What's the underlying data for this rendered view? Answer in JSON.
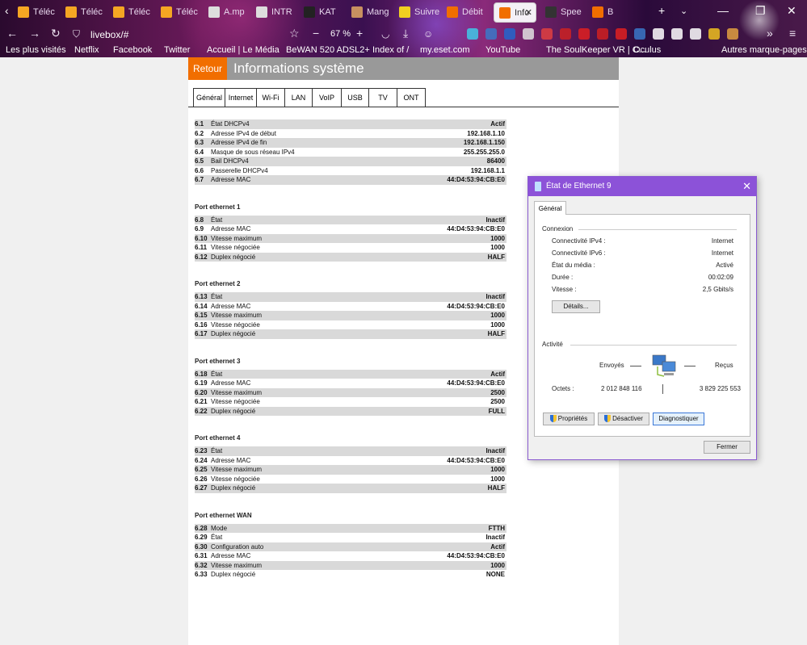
{
  "browser": {
    "tabs": [
      {
        "label": "Téléc",
        "color": "#f5a623"
      },
      {
        "label": "Téléc",
        "color": "#f5a623"
      },
      {
        "label": "Téléc",
        "color": "#f5a623"
      },
      {
        "label": "Téléc",
        "color": "#f5a623"
      },
      {
        "label": "A.mp",
        "color": "#dddddd"
      },
      {
        "label": "INTR",
        "color": "#dddddd"
      },
      {
        "label": "KAT",
        "color": "#222222"
      },
      {
        "label": "Mang",
        "color": "#c89060"
      },
      {
        "label": "Suivre",
        "color": "#f0d020"
      },
      {
        "label": "Débit",
        "color": "#f16e00"
      },
      {
        "label": "Info",
        "color": "#f16e00"
      },
      {
        "label": "Spee",
        "color": "#333333"
      },
      {
        "label": "B",
        "color": "#f16e00"
      }
    ],
    "url": "livebox/#",
    "zoom": "67 %",
    "bookmarks": [
      "Les plus visités",
      "Netflix",
      "Facebook",
      "Twitter",
      "Accueil | Le Média",
      "BeWAN 520 ADSL2+",
      "Index of /",
      "my.eset.com",
      "YouTube",
      "The SoulKeeper VR | C...",
      "Oculus",
      "Autres marque-pages"
    ]
  },
  "page": {
    "retour": "Retour",
    "title": "Informations système",
    "tabs": [
      "Général",
      "Internet",
      "Wi-Fi",
      "LAN",
      "VoIP",
      "USB",
      "TV",
      "ONT"
    ],
    "sections": [
      {
        "title": "",
        "rows": [
          [
            "6.1",
            "État DHCPv4",
            "Actif"
          ],
          [
            "6.2",
            "Adresse IPv4 de début",
            "192.168.1.10"
          ],
          [
            "6.3",
            "Adresse IPv4 de fin",
            "192.168.1.150"
          ],
          [
            "6.4",
            "Masque de sous réseau IPv4",
            "255.255.255.0"
          ],
          [
            "6.5",
            "Bail DHCPv4",
            "86400"
          ],
          [
            "6.6",
            "Passerelle DHCPv4",
            "192.168.1.1"
          ],
          [
            "6.7",
            "Adresse MAC",
            "44:D4:53:94:CB:E0"
          ]
        ]
      },
      {
        "title": "Port ethernet 1",
        "rows": [
          [
            "6.8",
            "État",
            "Inactif"
          ],
          [
            "6.9",
            "Adresse MAC",
            "44:D4:53:94:CB:E0"
          ],
          [
            "6.10",
            "Vitesse maximum",
            "1000"
          ],
          [
            "6.11",
            "Vitesse négociée",
            "1000"
          ],
          [
            "6.12",
            "Duplex négocié",
            "HALF"
          ]
        ]
      },
      {
        "title": "Port ethernet 2",
        "rows": [
          [
            "6.13",
            "État",
            "Inactif"
          ],
          [
            "6.14",
            "Adresse MAC",
            "44:D4:53:94:CB:E0"
          ],
          [
            "6.15",
            "Vitesse maximum",
            "1000"
          ],
          [
            "6.16",
            "Vitesse négociée",
            "1000"
          ],
          [
            "6.17",
            "Duplex négocié",
            "HALF"
          ]
        ]
      },
      {
        "title": "Port ethernet 3",
        "rows": [
          [
            "6.18",
            "État",
            "Actif"
          ],
          [
            "6.19",
            "Adresse MAC",
            "44:D4:53:94:CB:E0"
          ],
          [
            "6.20",
            "Vitesse maximum",
            "2500"
          ],
          [
            "6.21",
            "Vitesse négociée",
            "2500"
          ],
          [
            "6.22",
            "Duplex négocié",
            "FULL"
          ]
        ]
      },
      {
        "title": "Port ethernet 4",
        "rows": [
          [
            "6.23",
            "État",
            "Inactif"
          ],
          [
            "6.24",
            "Adresse MAC",
            "44:D4:53:94:CB:E0"
          ],
          [
            "6.25",
            "Vitesse maximum",
            "1000"
          ],
          [
            "6.26",
            "Vitesse négociée",
            "1000"
          ],
          [
            "6.27",
            "Duplex négocié",
            "HALF"
          ]
        ]
      },
      {
        "title": "Port ethernet WAN",
        "rows": [
          [
            "6.28",
            "Mode",
            "FTTH"
          ],
          [
            "6.29",
            "État",
            "Inactif"
          ],
          [
            "6.30",
            "Configuration auto",
            "Actif"
          ],
          [
            "6.31",
            "Adresse MAC",
            "44:D4:53:94:CB:E0"
          ],
          [
            "6.32",
            "Vitesse maximum",
            "1000"
          ],
          [
            "6.33",
            "Duplex négocié",
            "NONE"
          ]
        ]
      }
    ]
  },
  "dialog": {
    "title": "État de Ethernet 9",
    "tab": "Général",
    "connexion_label": "Connexion",
    "fields": [
      [
        "Connectivité IPv4 :",
        "Internet"
      ],
      [
        "Connectivité IPv6 :",
        "Internet"
      ],
      [
        "État du média :",
        "Activé"
      ],
      [
        "Durée :",
        "00:02:09"
      ],
      [
        "Vitesse :",
        "2,5 Gbits/s"
      ]
    ],
    "details_button": "Détails...",
    "activite_label": "Activité",
    "sent_label": "Envoyés",
    "recv_label": "Reçus",
    "octets_label": "Octets :",
    "octets_sent": "2 012 848 116",
    "octets_recv": "3 829 225 553",
    "properties_button": "Propriétés",
    "disable_button": "Désactiver",
    "diagnose_button": "Diagnostiquer",
    "close_button": "Fermer"
  }
}
